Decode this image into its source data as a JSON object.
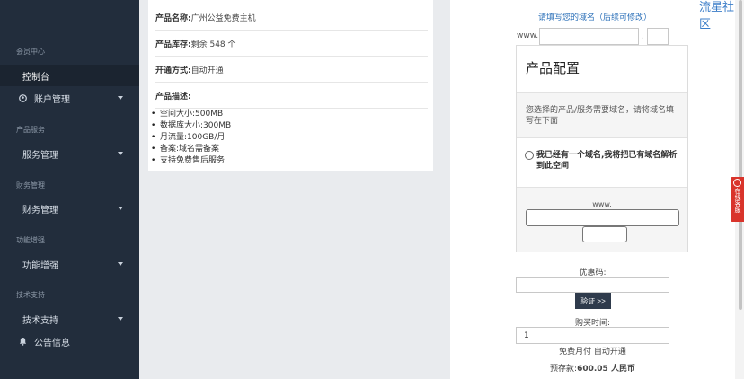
{
  "sidebar": {
    "groups": [
      "会员中心",
      "产品服务",
      "财务管理",
      "功能增强",
      "技术支持"
    ],
    "items": [
      {
        "label": "控制台"
      },
      {
        "label": "账户管理"
      },
      {
        "label": "服务管理"
      },
      {
        "label": "财务管理"
      },
      {
        "label": "功能增强"
      },
      {
        "label": "技术支持"
      },
      {
        "label": "公告信息"
      }
    ]
  },
  "product": {
    "name_label": "产品名称:",
    "name_value": "广州公益免费主机",
    "stock_label": "产品库存:",
    "stock_value": "剩余 548 个",
    "activation_label": "开通方式:",
    "activation_value": "自动开通",
    "desc_label": "产品描述:",
    "desc_items": [
      "空间大小:500MB",
      "数据库大小:300MB",
      "月流量:100GB/月",
      "备案:域名需备案",
      "支持免费售后服务"
    ]
  },
  "order": {
    "domain_hint": "请填写您的域名（后续可修改）",
    "www_prefix": "www.",
    "dot": ".",
    "config_title": "产品配置",
    "config_note": "您选择的产品/服务需要域名，请将域名填写在下面",
    "radio_label": "我已经有一个域名,我将把已有域名解析到此空间",
    "www_prefix2": "www.",
    "dot2": ".",
    "coupon_label": "优惠码:",
    "verify_button": "验证 >>",
    "purchase_time_label": "购买时间:",
    "quantity_value": "1",
    "billing_text": "免费月付 自动开通",
    "prepay_label": "预存款:",
    "prepay_value": "600.05 人民币"
  },
  "watermark": "流星社区",
  "float_tab": {
    "text": "在线客服"
  }
}
